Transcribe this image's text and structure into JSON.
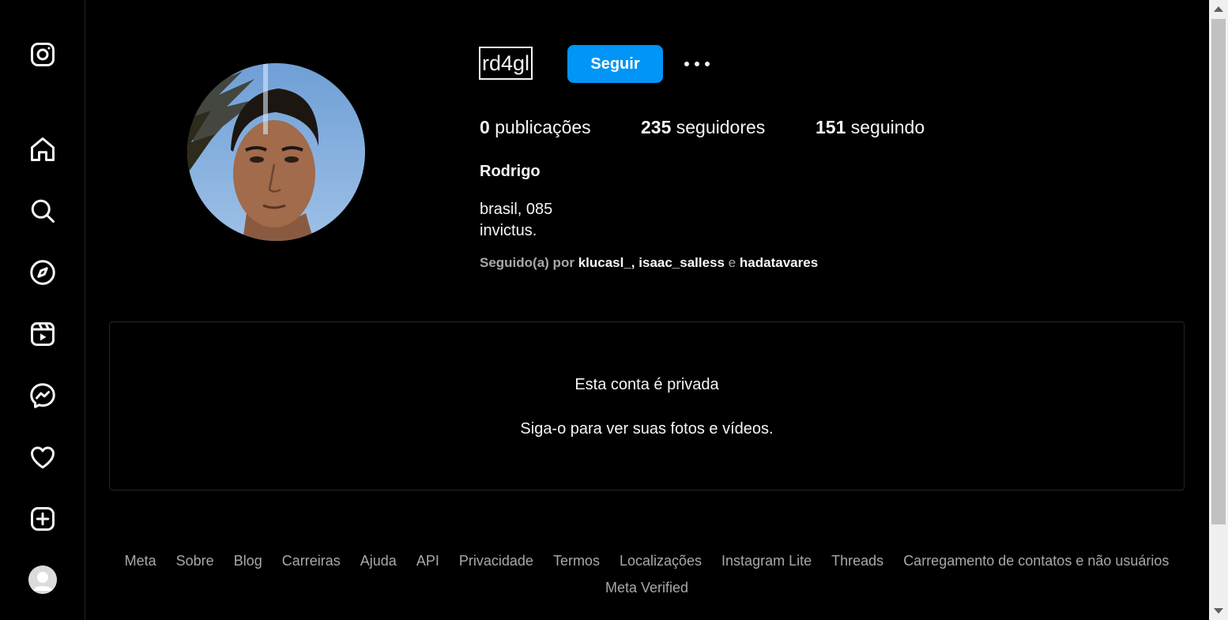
{
  "sidebar": {
    "icons": [
      "instagram-logo-icon",
      "home-icon",
      "search-icon",
      "explore-icon",
      "reels-icon",
      "messenger-icon",
      "heart-icon",
      "create-icon",
      "profile-avatar"
    ]
  },
  "profile": {
    "username": "rd4gl",
    "follow_label": "Seguir",
    "posts_count": "0",
    "posts_label": "publicações",
    "followers_count": "235",
    "followers_label": "seguidores",
    "following_count": "151",
    "following_label": "seguindo",
    "full_name": "Rodrigo",
    "bio_line1": "brasil, 085",
    "bio_line2": "invictus.",
    "followed_by_prefix": "Seguido(a) por",
    "followed_by_user1": "klucasl_",
    "followed_by_sep": ",",
    "followed_by_user2": "isaac_salless",
    "followed_by_and": "e",
    "followed_by_user3": "hadatavares"
  },
  "private": {
    "title": "Esta conta é privada",
    "subtitle": "Siga-o para ver suas fotos e vídeos."
  },
  "footer": {
    "links": [
      "Meta",
      "Sobre",
      "Blog",
      "Carreiras",
      "Ajuda",
      "API",
      "Privacidade",
      "Termos",
      "Localizações",
      "Instagram Lite",
      "Threads",
      "Carregamento de contatos e não usuários"
    ],
    "row2": "Meta Verified"
  },
  "colors": {
    "accent": "#0095f6",
    "background": "#000000",
    "text": "#f5f5f5",
    "secondary_text": "#a8a8a8"
  }
}
